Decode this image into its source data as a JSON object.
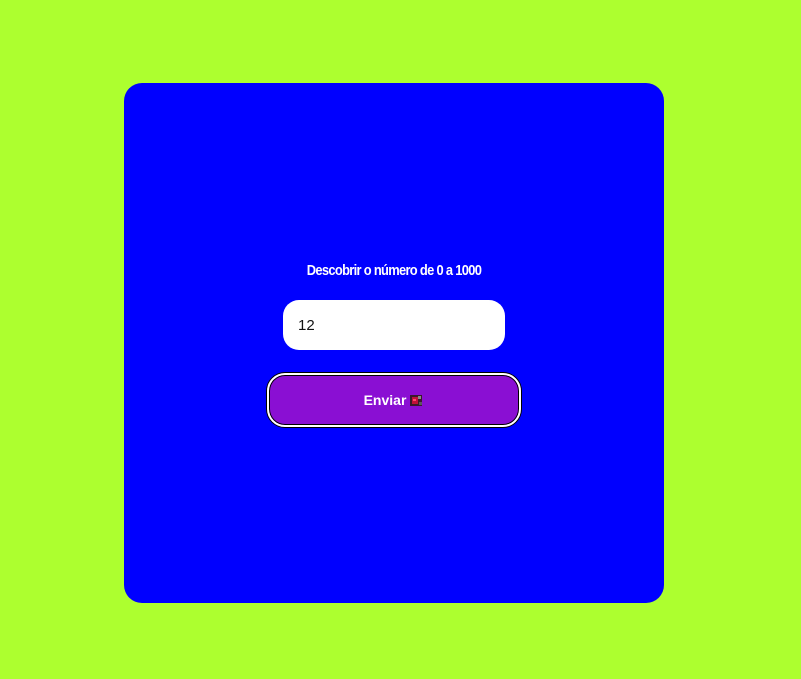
{
  "form": {
    "title": "Descobrir o número de 0 a 1000",
    "input_value": "12",
    "submit_label": "Enviar",
    "submit_icon": "rocket-icon"
  },
  "colors": {
    "page_background": "#adff2f",
    "card_background": "#0000ff",
    "button_background": "#8a0fd3",
    "text": "#ffffff"
  }
}
